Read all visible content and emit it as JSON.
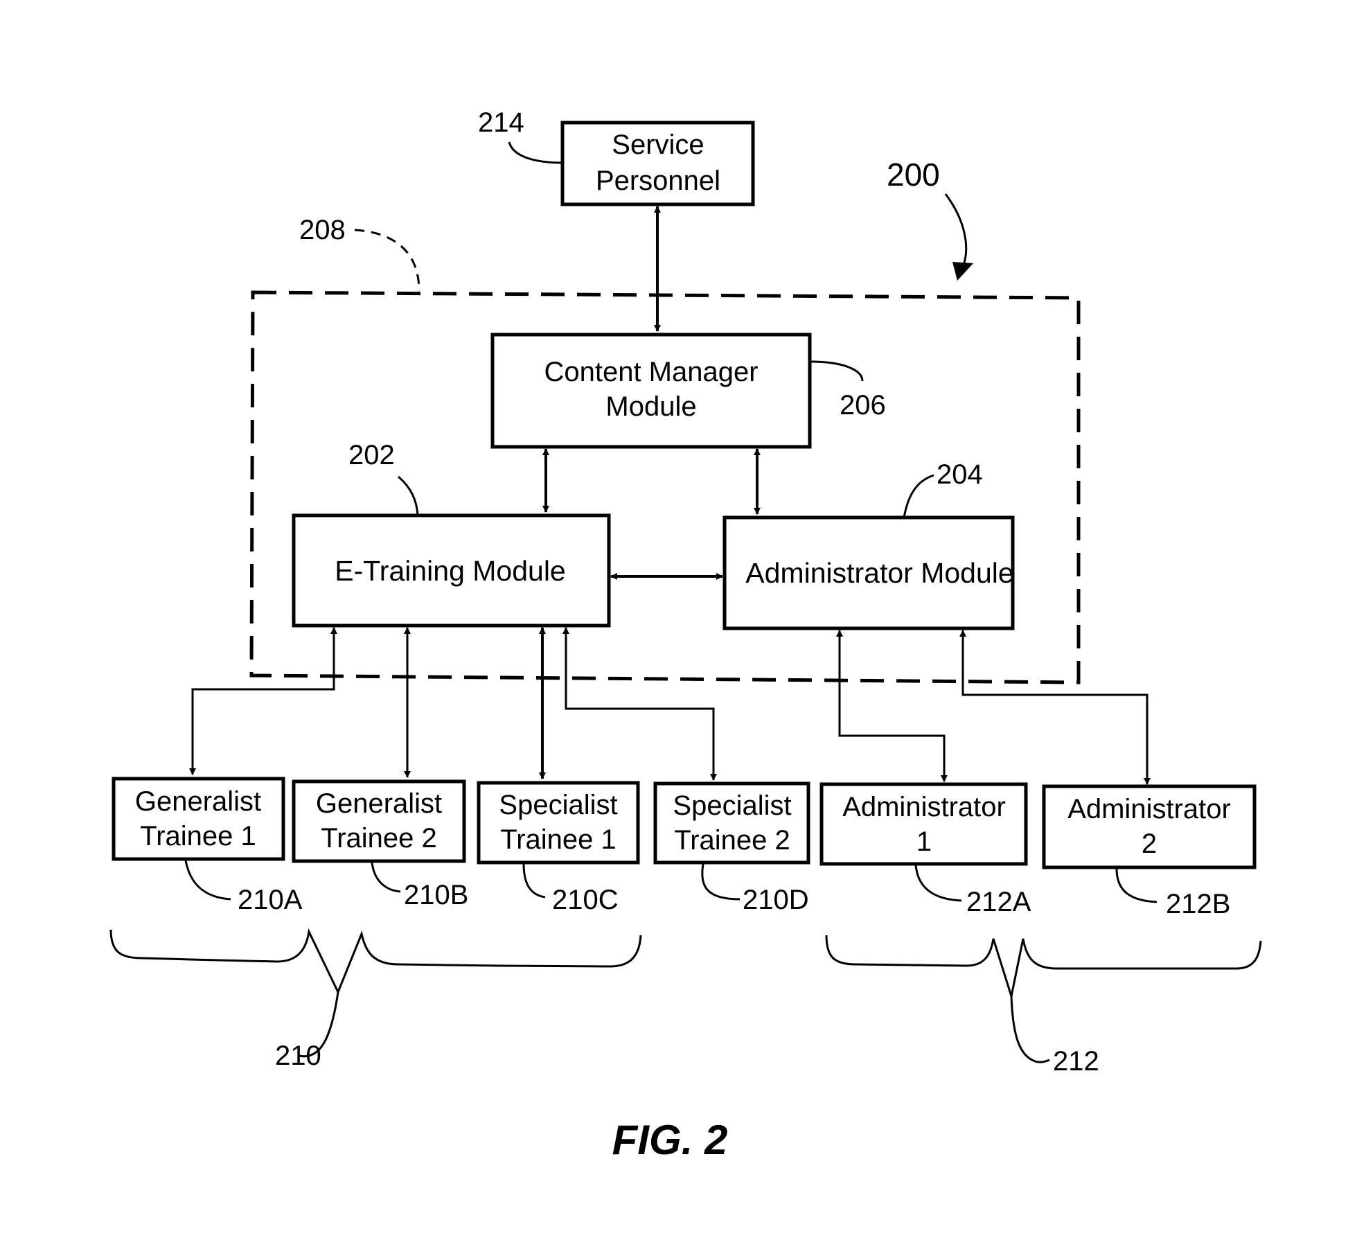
{
  "figure": {
    "caption": "FIG. 2",
    "system_ref": "200",
    "system_boundary_ref": "208"
  },
  "nodes": {
    "service_personnel": {
      "line1": "Service",
      "line2": "Personnel",
      "ref": "214"
    },
    "content_manager": {
      "line1": "Content Manager",
      "line2": "Module",
      "ref": "206"
    },
    "e_training": {
      "label": "E-Training Module",
      "ref": "202"
    },
    "admin_module": {
      "label": "Administrator Module",
      "ref": "204"
    }
  },
  "trainees": [
    {
      "line1": "Generalist",
      "line2": "Trainee 1",
      "ref": "210A"
    },
    {
      "line1": "Generalist",
      "line2": "Trainee 2",
      "ref": "210B"
    },
    {
      "line1": "Specialist",
      "line2": "Trainee 1",
      "ref": "210C"
    },
    {
      "line1": "Specialist",
      "line2": "Trainee 2",
      "ref": "210D"
    }
  ],
  "administrators": [
    {
      "line1": "Administrator",
      "line2": "1",
      "ref": "212A"
    },
    {
      "line1": "Administrator",
      "line2": "2",
      "ref": "212B"
    }
  ],
  "groups": {
    "trainees_ref": "210",
    "administrators_ref": "212"
  },
  "connections": [
    {
      "from": "Service Personnel",
      "to": "Content Manager Module",
      "direction": "bidirectional"
    },
    {
      "from": "Content Manager Module",
      "to": "E-Training Module",
      "direction": "bidirectional"
    },
    {
      "from": "Content Manager Module",
      "to": "Administrator Module",
      "direction": "bidirectional"
    },
    {
      "from": "E-Training Module",
      "to": "Administrator Module",
      "direction": "bidirectional"
    },
    {
      "from": "E-Training Module",
      "to": "Generalist Trainee 1",
      "direction": "bidirectional"
    },
    {
      "from": "E-Training Module",
      "to": "Generalist Trainee 2",
      "direction": "bidirectional"
    },
    {
      "from": "E-Training Module",
      "to": "Specialist Trainee 1",
      "direction": "bidirectional"
    },
    {
      "from": "E-Training Module",
      "to": "Specialist Trainee 2",
      "direction": "bidirectional"
    },
    {
      "from": "Administrator Module",
      "to": "Administrator 1",
      "direction": "bidirectional"
    },
    {
      "from": "Administrator Module",
      "to": "Administrator 2",
      "direction": "bidirectional"
    }
  ]
}
